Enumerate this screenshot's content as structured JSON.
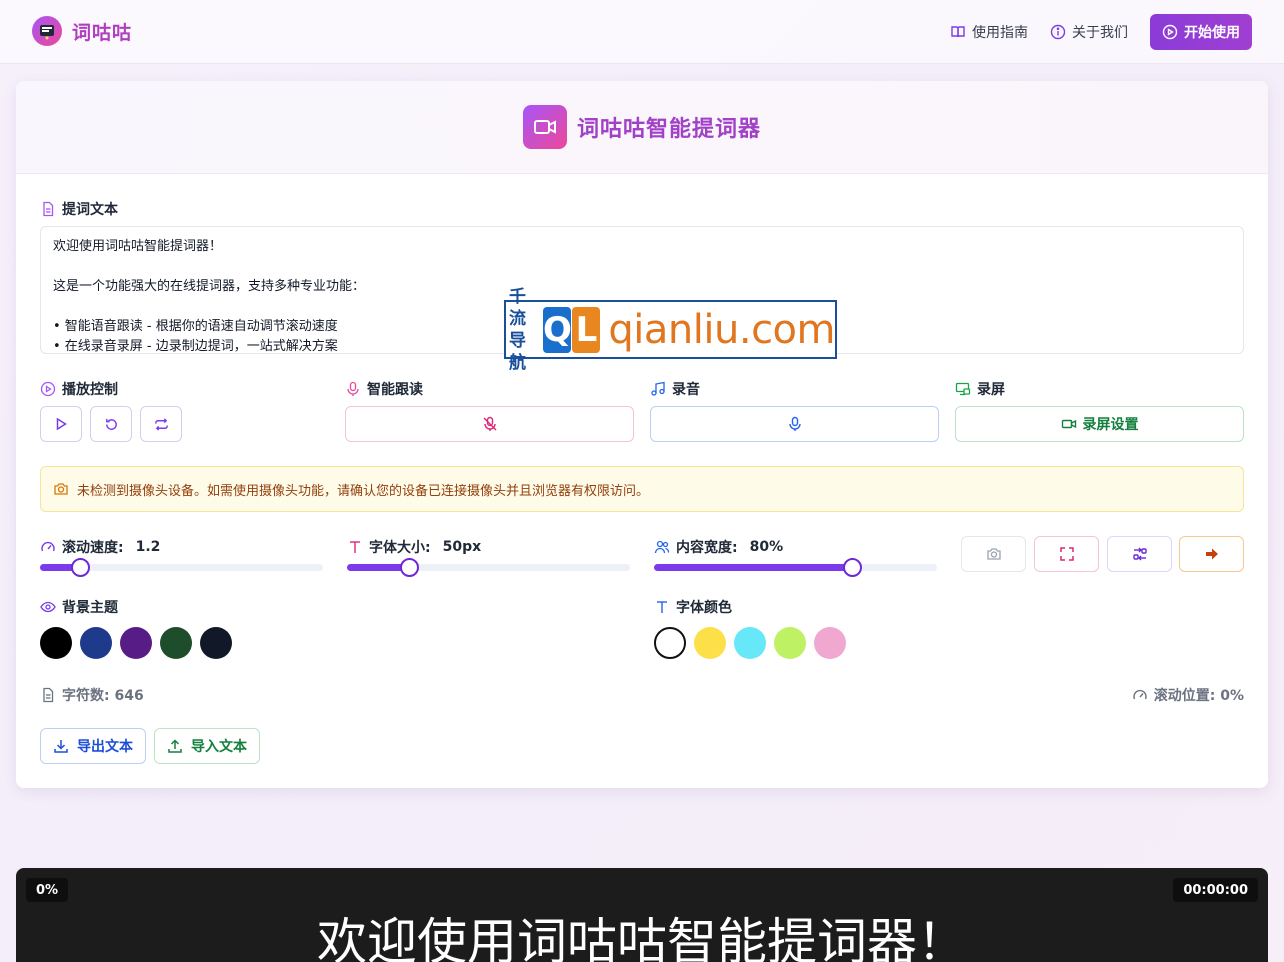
{
  "app": {
    "brand": "词咕咕",
    "nav": {
      "guide": "使用指南",
      "about": "关于我们",
      "start": "开始使用"
    }
  },
  "card": {
    "title": "词咕咕智能提词器",
    "text_section_label": "提词文本",
    "text_lines": [
      "欢迎使用词咕咕智能提词器！",
      "",
      "这是一个功能强大的在线提词器，支持多种专业功能：",
      "",
      "• 智能语音跟读 - 根据你的语速自动调节滚动速度",
      "• 在线录音录屏 - 边录制边提词，一站式解决方案"
    ],
    "groups": {
      "playback": "播放控制",
      "voice_follow": "智能跟读",
      "record_audio": "录音",
      "record_screen": "录屏",
      "record_screen_button": "录屏设置"
    },
    "notice": "未检测到摄像头设备。如需使用摄像头功能，请确认您的设备已连接摄像头并且浏览器有权限访问。",
    "sliders": {
      "speed": {
        "label": "滚动速度:",
        "value": "1.2",
        "fraction": 0.14
      },
      "font_size": {
        "label": "字体大小:",
        "value": "50px",
        "fraction": 0.22
      },
      "width": {
        "label": "内容宽度:",
        "value": "80%",
        "fraction": 0.7
      }
    },
    "bg_theme": {
      "label": "背景主题",
      "colors": [
        "#000000",
        "#1e3a8a",
        "#581c87",
        "#1d4d2b",
        "#111827"
      ]
    },
    "font_color": {
      "label": "字体颜色",
      "colors": [
        "#ffffff",
        "#fde047",
        "#67e8f9",
        "#bef264",
        "#f0a8d0"
      ]
    },
    "char_count": "字符数: 646",
    "scroll_pos": "滚动位置: 0%",
    "export_label": "导出文本",
    "import_label": "导入文本"
  },
  "watermark": {
    "cn_top": "千流",
    "cn_bottom": "导航",
    "q": "Q",
    "l": "L",
    "domain": "qianliu.com"
  },
  "prompter": {
    "percent": "0%",
    "timer": "00:00:00",
    "text": "欢迎使用词咕咕智能提词器！"
  },
  "colors": {
    "accent": "#8b3bd9",
    "brand_pink": "#ec4899",
    "record_green": "#15803d",
    "warning": "#92400e"
  }
}
